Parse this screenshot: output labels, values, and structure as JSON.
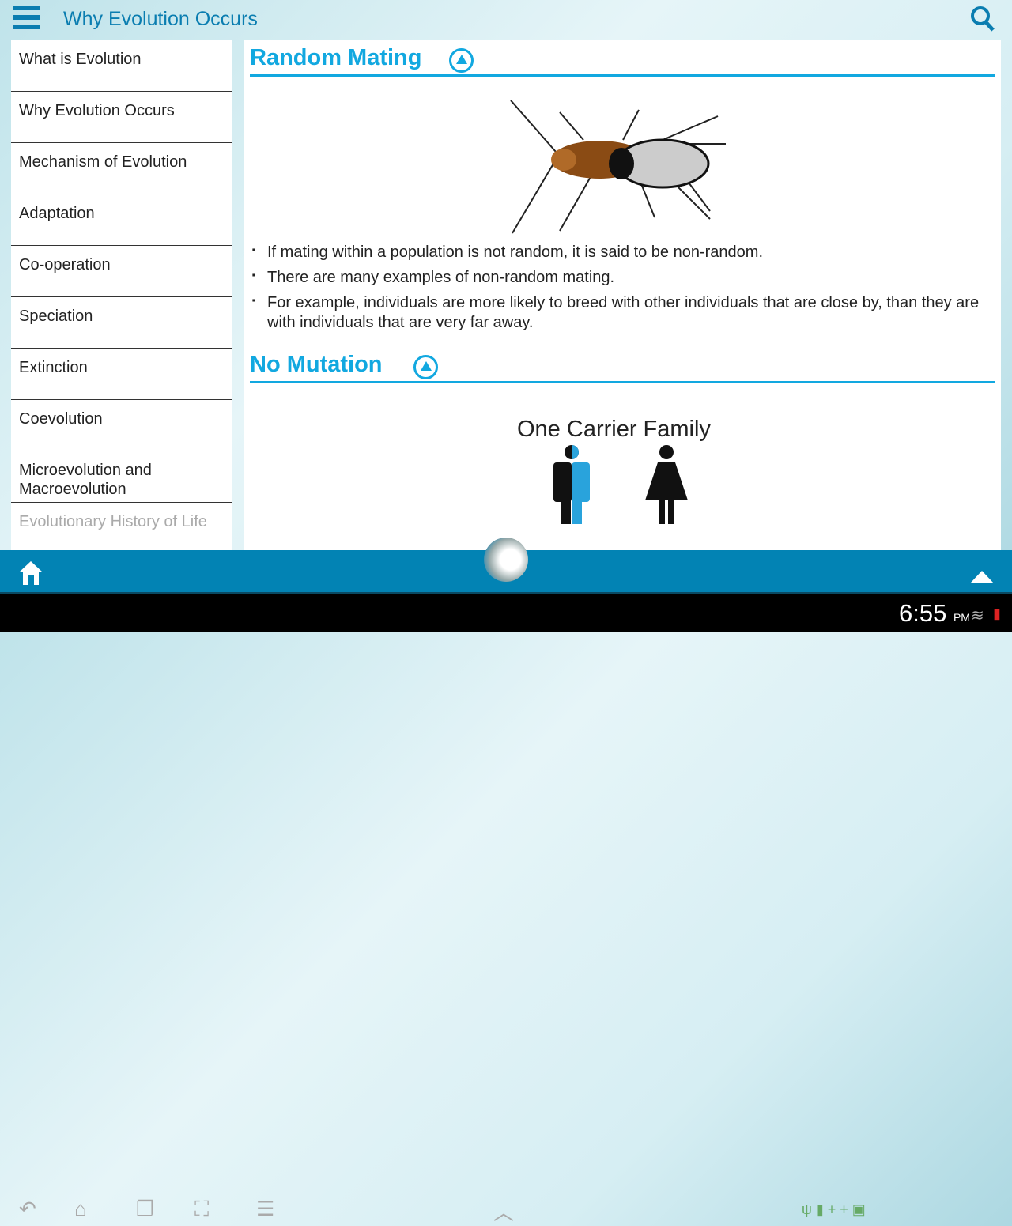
{
  "header": {
    "title": "Why Evolution Occurs",
    "menu_icon": "hamburger-icon",
    "search_icon": "search-icon"
  },
  "sidebar": {
    "items": [
      {
        "label": "What is Evolution"
      },
      {
        "label": "Why Evolution Occurs"
      },
      {
        "label": "Mechanism of Evolution"
      },
      {
        "label": "Adaptation"
      },
      {
        "label": "Co-operation"
      },
      {
        "label": "Speciation"
      },
      {
        "label": "Extinction"
      },
      {
        "label": "Coevolution"
      },
      {
        "label": "Microevolution and Macroevolution"
      },
      {
        "label": "Evolutionary History of Life"
      }
    ]
  },
  "main": {
    "sections": [
      {
        "title": "Random Mating",
        "bullets": [
          "If mating within a population is not random, it is said to be non-random.",
          "There are many examples of non-random mating.",
          "For example, individuals are more likely to breed with other individuals that are close by, than they are with individuals that are very far away."
        ]
      },
      {
        "title": "No Mutation",
        "figure_title": "One Carrier Family"
      }
    ]
  },
  "status": {
    "time": "6:55",
    "ampm": "PM"
  },
  "colors": {
    "accent": "#12a8e0",
    "bar": "#0283b4"
  }
}
